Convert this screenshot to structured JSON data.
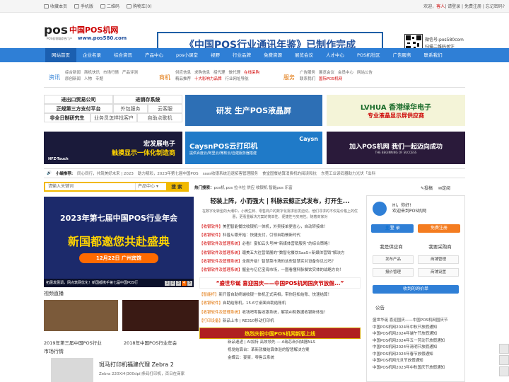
{
  "topbar": {
    "bookmark": "收藏本页",
    "mobile": "手机版",
    "qrcode": "二维码",
    "cart": "购物车(0)",
    "welcome_pre": "欢迎，",
    "guest": "客人",
    "welcome_post": "| 请登录 | 免费注册 | 忘记密码?"
  },
  "header": {
    "logo_text": "中国POS机网",
    "logo_url": "www.pos580.com",
    "logo_sub": "POS机领域综合门户",
    "banner_text": "《中国POS行业通讯年鉴》已制作完成",
    "wechat_label": "微信号:pos580com",
    "wechat_scan": "扫描二维码关注"
  },
  "nav": [
    "网站首页",
    "企业名录",
    "综合资讯",
    "产品中心",
    "pos小课堂",
    "视野",
    "行业品牌",
    "免费资源",
    "展览会议",
    "人才中心",
    "POS机社区",
    "广告服务",
    "联系我们"
  ],
  "subnav": [
    {
      "icon": "资讯",
      "links": [
        "综合新闻",
        "商机快讯",
        "市场行情",
        "产品评测",
        "原创新闻",
        "人物",
        "专题"
      ],
      "hl": []
    },
    {
      "icon": "商机",
      "links": [
        "供应信息",
        "求购信息",
        "招代理",
        "做代理",
        "在线采购",
        "精品推荐",
        "十大影响力品牌",
        "行业网址导航"
      ],
      "hl": [
        "在线采购",
        "十大影响力品牌"
      ]
    },
    {
      "icon": "服务",
      "links": [
        "广告服务",
        "展览会议",
        "会员中心",
        "网站公告",
        "联系我们",
        "国际POS机网"
      ],
      "hl": [
        "国际POS机网"
      ]
    }
  ],
  "left_links": [
    {
      "text": "进出口贸易公司",
      "light": false
    },
    {
      "text": "进销存系统",
      "light": false
    },
    {
      "text": "正规第三方支付平台",
      "light": false
    },
    {
      "text": "外包服务",
      "light": true
    },
    {
      "text": "云客服",
      "light": true
    },
    {
      "text": "非全日制研究生",
      "light": false
    },
    {
      "text": "业务员怎样找客户",
      "light": true
    },
    {
      "text": "自助点歌机",
      "light": true
    }
  ],
  "ads": {
    "ad1": "研发 生产POS液晶屏",
    "ad2": "LVHUA 香港绿华电子",
    "ad2_sub": "专业液晶显示屏供应商",
    "ad3": "宏发展电子",
    "ad3_sub": "触摸显示一体化制造商",
    "ad3_brand": "HFZ-Touch",
    "ad4": "CaysnPOS云打印机",
    "ad4_sub": "提供百度云/阿里云/微软云/自建服务器搭建",
    "ad4_brand": "Caysn",
    "ad5": "加入POS机网 我们一起迈向成功",
    "ad5_sub": "THE BEGINNING OF SUCCESS"
  },
  "ticker": {
    "label": "小编推荐:",
    "items": [
      "同心同行，共筑美好未来 | 2023",
      "助力精彩，2023年第七届中国POS",
      "saas收银系统迅速拓客管理服务",
      "食堂固餐结算消费机的阅读和抗",
      "东莞工业读码器助力光伏「出科"
    ]
  },
  "search": {
    "placeholder": "请输入关键词",
    "category": "产品中心",
    "button": "搜 索"
  },
  "hot": {
    "label": "热门搜索：",
    "items": "pos机 pos 拉卡拉 供应 收银机 智能pos 乐富"
  },
  "share": {
    "s1": "投稿",
    "s2": "定阅"
  },
  "main_banner": {
    "line1": "2023年第七届中国POS行业年会",
    "line2": "新国都邀您共赴盛典",
    "line3": "12月22日 广州宾馆",
    "caption": "拓展发展调，网点筑网优化！新国都携手第七届中国POS行",
    "dots": [
      "1",
      "2",
      "3",
      "4",
      "5"
    ]
  },
  "video": {
    "title": "视频直播",
    "cap1": "2019年第三届中国POS行业",
    "cap2": "2018年中国POS行业年会"
  },
  "market": {
    "title": "市场行情",
    "headline": "斑马打印机福建代理 Zebra 2",
    "desc": "Zebra 220Xi4(300dpi)条码打印机，百日在商家"
  },
  "news": {
    "headline": "轻装上阵，小而强大 | 科脉云鲸正式发布，打开生...",
    "summary": "在数字化转型的大潮中，小微生鲜、零售商户的数字化需求愈发迫切。他们寻求的不仅是价格上的优惠，更看重解决方案的简单性、便捷性与实用性。随着商家对",
    "items": [
      {
        "tag": "【收银软件】",
        "text": "美团智能餐饮收银机一体机，外卖接单更省心，自动转接单！"
      },
      {
        "tag": "【收银软件】",
        "text": "科普从哪开始：快捷支付，引领自助餐新时代"
      },
      {
        "tag": "【收银软件及管理系统】",
        "text": "必看！宴如云头号神“新媒体营销服务”的综合策略！"
      },
      {
        "tag": "【收银软件及管理系统】",
        "text": "瓏美五大往营销展的“数智化餐饮SaaS+新媒体营销”解决方"
      },
      {
        "tag": "【收银软件及管理系统】",
        "text": "全面升级！智慧菜市场的这些智慧实对设备你见过吗？"
      },
      {
        "tag": "【收银软件及管理系统】",
        "text": "握金与亿亿宝海市场，一图看懂科脉餐饮实体的战略方向！"
      }
    ],
    "headline2": "“盛世华诞 喜迎国庆——中国POS机网国庆节放假...”",
    "items2": [
      {
        "tag": "【智能杆】",
        "text": "新开普自助终端收银一体机正式亮相，带你轻松结账、快速结算！"
      },
      {
        "tag": "【收银软件】",
        "text": "自助结账机，15.6寸桌面自助结账机"
      },
      {
        "tag": "【收银软件及管理系统】",
        "text": "收钱吧零售收银系统，解锁AI和数据收银新体验！"
      },
      {
        "tag": "【打印设备】",
        "text": "新品上市 | RE310移动打印机"
      }
    ],
    "gbanner": "热烈庆祝中国POS机网新版上线",
    "last": [
      "新品速递 | AI加持 高效领先 — A瑞芯新扫描器NLS",
      "视觉结算台：革新就餐结算体验的智慧解决方案",
      "金蝶云：宴豪，零售云系统"
    ]
  },
  "sidebar": {
    "hello": "Hi，你好!",
    "welcome": "欢迎来到POS机网",
    "login": "登 录",
    "register": "免费注册",
    "tab_supply": "我是供应商",
    "tab_buy": "我要采购商",
    "boxes": [
      "发布产品",
      "商铺管理",
      "报价管理",
      "商铺设置"
    ],
    "collect": "收到的询价单",
    "notice_title": "公告",
    "notices": [
      "盛世华诞 喜迎国庆——中国POS机网国庆节",
      "中国POS机网2024年中秋节放假通知",
      "中国POS机网2024年端午节放假通知",
      "中国POS机网2024年五一劳动节放假通知",
      "中国POS机网2024年清明节放假通知",
      "中国POS机网2024年春节放假通知",
      "中国POS机网元旦节放假通知",
      "中国POS机网2023年中秋国庆节放假通知"
    ]
  }
}
